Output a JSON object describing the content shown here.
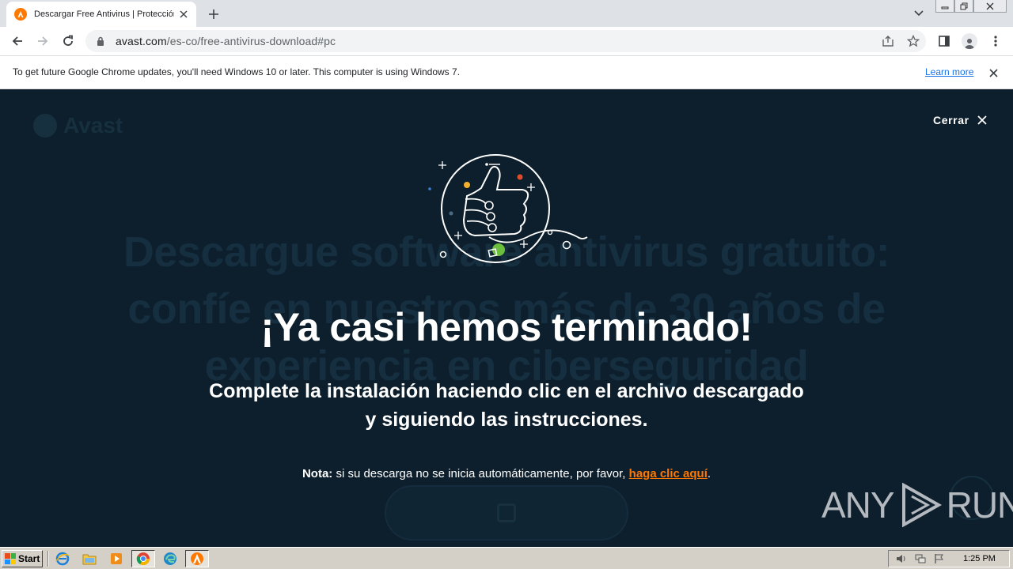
{
  "browser": {
    "tab": {
      "title": "Descargar Free Antivirus | Protección"
    },
    "address": {
      "host": "avast.com",
      "path": "/es-co/free-antivirus-download#pc"
    }
  },
  "infobar": {
    "message": "To get future Google Chrome updates, you'll need Windows 10 or later. This computer is using Windows 7.",
    "link": "Learn more"
  },
  "overlay": {
    "close_label": "Cerrar",
    "title": "¡Ya casi hemos terminado!",
    "subtitle_line1": "Complete la instalación haciendo clic en el archivo descargado",
    "subtitle_line2": "y siguiendo las instrucciones.",
    "note_label": "Nota:",
    "note_text": " si su descarga no se inicia automáticamente, por favor, ",
    "note_link": "haga clic aquí",
    "note_end": "."
  },
  "background_page": {
    "headline_1": "Descargue software antivirus gratuito:",
    "headline_2": "confíe en nuestros más de 30 años de",
    "headline_3": "experiencia en ciberseguridad"
  },
  "watermark": {
    "left": "ANY",
    "right": "RUN"
  },
  "taskbar": {
    "start_label": "Start",
    "clock": "1:25 PM",
    "apps": [
      "ie-icon",
      "explorer-icon",
      "media-player-icon",
      "chrome-icon",
      "edge-icon",
      "avast-icon"
    ]
  },
  "colors": {
    "accent": "#ff7800",
    "page_bg": "#0d1f2c",
    "link": "#1a73e8"
  }
}
